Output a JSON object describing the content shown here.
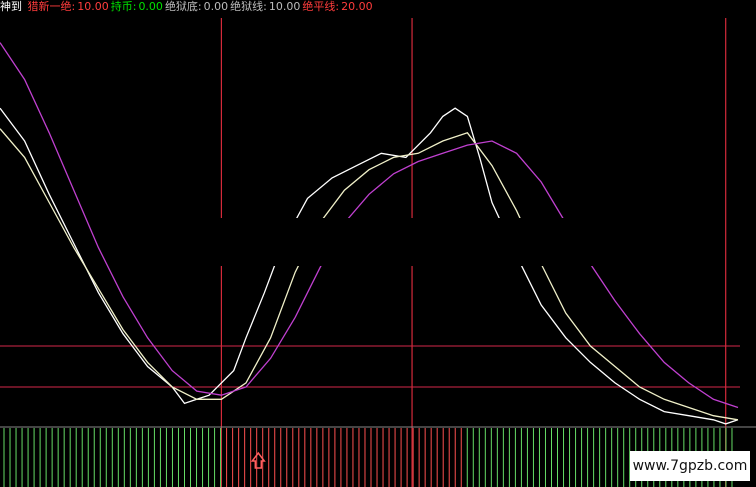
{
  "legend": {
    "indicator_name": "神到",
    "items": [
      {
        "label": "猎新一绝:",
        "value": "10.00",
        "color": "#ff3c3c"
      },
      {
        "label": "持币:",
        "value": "0.00",
        "color": "#00e000"
      },
      {
        "label": "绝狱底:",
        "value": "0.00",
        "color": "#bbbbbb"
      },
      {
        "label": "绝狱线:",
        "value": "10.00",
        "color": "#bbbbbb"
      },
      {
        "label": "绝平线:",
        "value": "20.00",
        "color": "#ff3c3c"
      }
    ]
  },
  "watermark": "www.7gpzb.com",
  "colors": {
    "background": "#000000",
    "white_line": "#ffffff",
    "lagged_line": "#f0f0c8",
    "purple_line": "#c040d0",
    "vertical_marker": "#d42a3a",
    "horizontal_marker": "#d4284a",
    "up_bar": "#ff5050",
    "down_bar": "#66dd66",
    "arrow": "#ff6060"
  },
  "chart_data": {
    "type": "line",
    "title": "",
    "xlabel": "",
    "ylabel": "",
    "x_range": [
      0,
      120
    ],
    "y_range": [
      0,
      100
    ],
    "reference_levels": [
      10,
      20
    ],
    "vertical_markers": [
      36,
      67,
      118
    ],
    "series": [
      {
        "key": "white",
        "x": [
          0,
          4,
          8,
          12,
          16,
          20,
          24,
          28,
          30,
          32,
          34,
          36,
          38,
          40,
          43,
          46,
          50,
          54,
          58,
          62,
          66,
          70,
          72,
          74,
          76,
          78,
          80,
          84,
          88,
          92,
          96,
          100,
          104,
          108,
          112,
          116,
          118,
          120
        ],
        "values": [
          78,
          70,
          57,
          45,
          33,
          23,
          15,
          10,
          6,
          7,
          8,
          11,
          14,
          22,
          33,
          45,
          56,
          61,
          64,
          67,
          66,
          72,
          76,
          78,
          76,
          66,
          55,
          42,
          30,
          22,
          16,
          11,
          7,
          4,
          3,
          2,
          1,
          2
        ]
      },
      {
        "key": "lagged",
        "x": [
          0,
          4,
          8,
          12,
          16,
          20,
          24,
          28,
          32,
          36,
          40,
          44,
          48,
          52,
          56,
          60,
          64,
          68,
          72,
          76,
          80,
          84,
          88,
          92,
          96,
          100,
          104,
          108,
          112,
          116,
          120
        ],
        "values": [
          73,
          66,
          55,
          44,
          34,
          24,
          16,
          10,
          7,
          7,
          11,
          22,
          38,
          50,
          58,
          63,
          66,
          67,
          70,
          72,
          64,
          53,
          40,
          28,
          20,
          15,
          10,
          7,
          5,
          3,
          2
        ]
      },
      {
        "key": "purple",
        "x": [
          0,
          4,
          8,
          12,
          16,
          20,
          24,
          28,
          32,
          36,
          40,
          44,
          48,
          52,
          56,
          60,
          64,
          68,
          72,
          76,
          80,
          84,
          88,
          92,
          96,
          100,
          104,
          108,
          112,
          116,
          120
        ],
        "values": [
          94,
          85,
          72,
          58,
          44,
          32,
          22,
          14,
          9,
          8,
          10,
          17,
          27,
          39,
          50,
          57,
          62,
          65,
          67,
          69,
          70,
          67,
          60,
          50,
          40,
          31,
          23,
          16,
          11,
          7,
          5
        ]
      }
    ],
    "histogram": {
      "direction": [
        "down",
        "down",
        "down",
        "down",
        "down",
        "down",
        "down",
        "down",
        "down",
        "down",
        "down",
        "down",
        "down",
        "down",
        "down",
        "down",
        "down",
        "down",
        "down",
        "down",
        "down",
        "down",
        "down",
        "down",
        "down",
        "down",
        "down",
        "down",
        "down",
        "down",
        "down",
        "down",
        "down",
        "down",
        "down",
        "down",
        "down",
        "up",
        "up",
        "up",
        "up",
        "up",
        "up",
        "up",
        "up",
        "up",
        "up",
        "up",
        "up",
        "up",
        "up",
        "up",
        "up",
        "up",
        "up",
        "up",
        "up",
        "up",
        "up",
        "up",
        "up",
        "up",
        "up",
        "up",
        "up",
        "up",
        "up",
        "up",
        "up",
        "up",
        "up",
        "up",
        "up",
        "up",
        "up",
        "up",
        "up",
        "down",
        "down",
        "down",
        "down",
        "down",
        "down",
        "down",
        "down",
        "down",
        "down",
        "down",
        "down",
        "down",
        "down",
        "down",
        "down",
        "down",
        "down",
        "down",
        "down",
        "down",
        "down",
        "down",
        "down",
        "down",
        "down",
        "down",
        "down",
        "down",
        "down",
        "down",
        "down",
        "down",
        "down",
        "down",
        "down",
        "down",
        "down",
        "down",
        "down",
        "down",
        "down",
        "down",
        "down",
        "down"
      ]
    },
    "signal_arrow_x": 42
  }
}
